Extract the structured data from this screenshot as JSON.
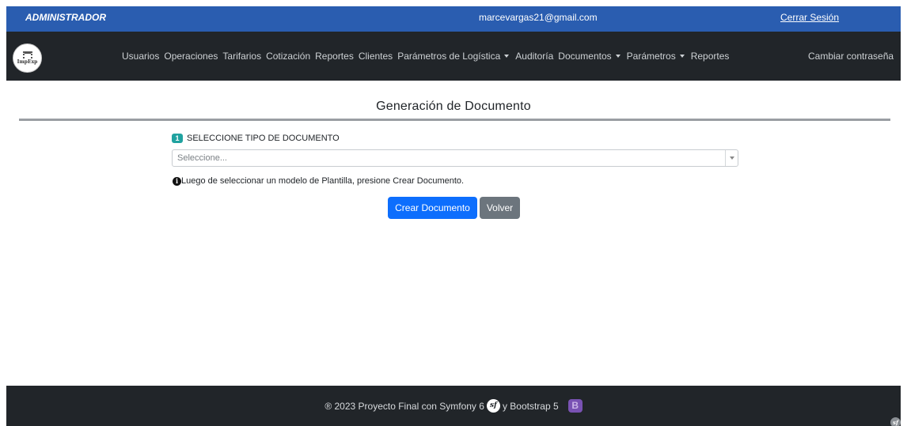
{
  "topbar": {
    "role": "ADMINISTRADOR",
    "email": "marcevargas21@gmail.com",
    "logout_label": "Cerrar Sesión",
    "background": "#2a5db0"
  },
  "navbar": {
    "logo_text": "ImpExp",
    "items": [
      {
        "label": "Usuarios",
        "dropdown": false
      },
      {
        "label": "Operaciones",
        "dropdown": false
      },
      {
        "label": "Tarifarios",
        "dropdown": false
      },
      {
        "label": "Cotización",
        "dropdown": false
      },
      {
        "label": "Reportes",
        "dropdown": false
      },
      {
        "label": "Clientes",
        "dropdown": false
      },
      {
        "label": "Parámetros de Logística",
        "dropdown": true
      },
      {
        "label": "Auditoría",
        "dropdown": false
      },
      {
        "label": "Documentos",
        "dropdown": true
      },
      {
        "label": "Parámetros",
        "dropdown": true
      },
      {
        "label": "Reportes",
        "dropdown": false
      }
    ],
    "right_link": "Cambiar contraseña",
    "background": "#212529"
  },
  "main": {
    "title": "Generación de Documento",
    "step_number": "1",
    "field_label": "SELECCIONE TIPO DE DOCUMENTO",
    "select_placeholder": "Seleccione...",
    "hint_icon": "info-circle-icon",
    "hint_text": "Luego de seleccionar un modelo de Plantilla, presione Crear Documento.",
    "primary_button": "Crear Documento",
    "secondary_button": "Volver",
    "primary_color": "#0d6efd",
    "secondary_color": "#6c757d"
  },
  "footer": {
    "text_before": "® 2023 Proyecto Final con Symfony 6",
    "text_after": "y Bootstrap 5",
    "symfony_logo_text": "sf",
    "bootstrap_logo_text": "B",
    "corner_logo_text": "sf"
  }
}
